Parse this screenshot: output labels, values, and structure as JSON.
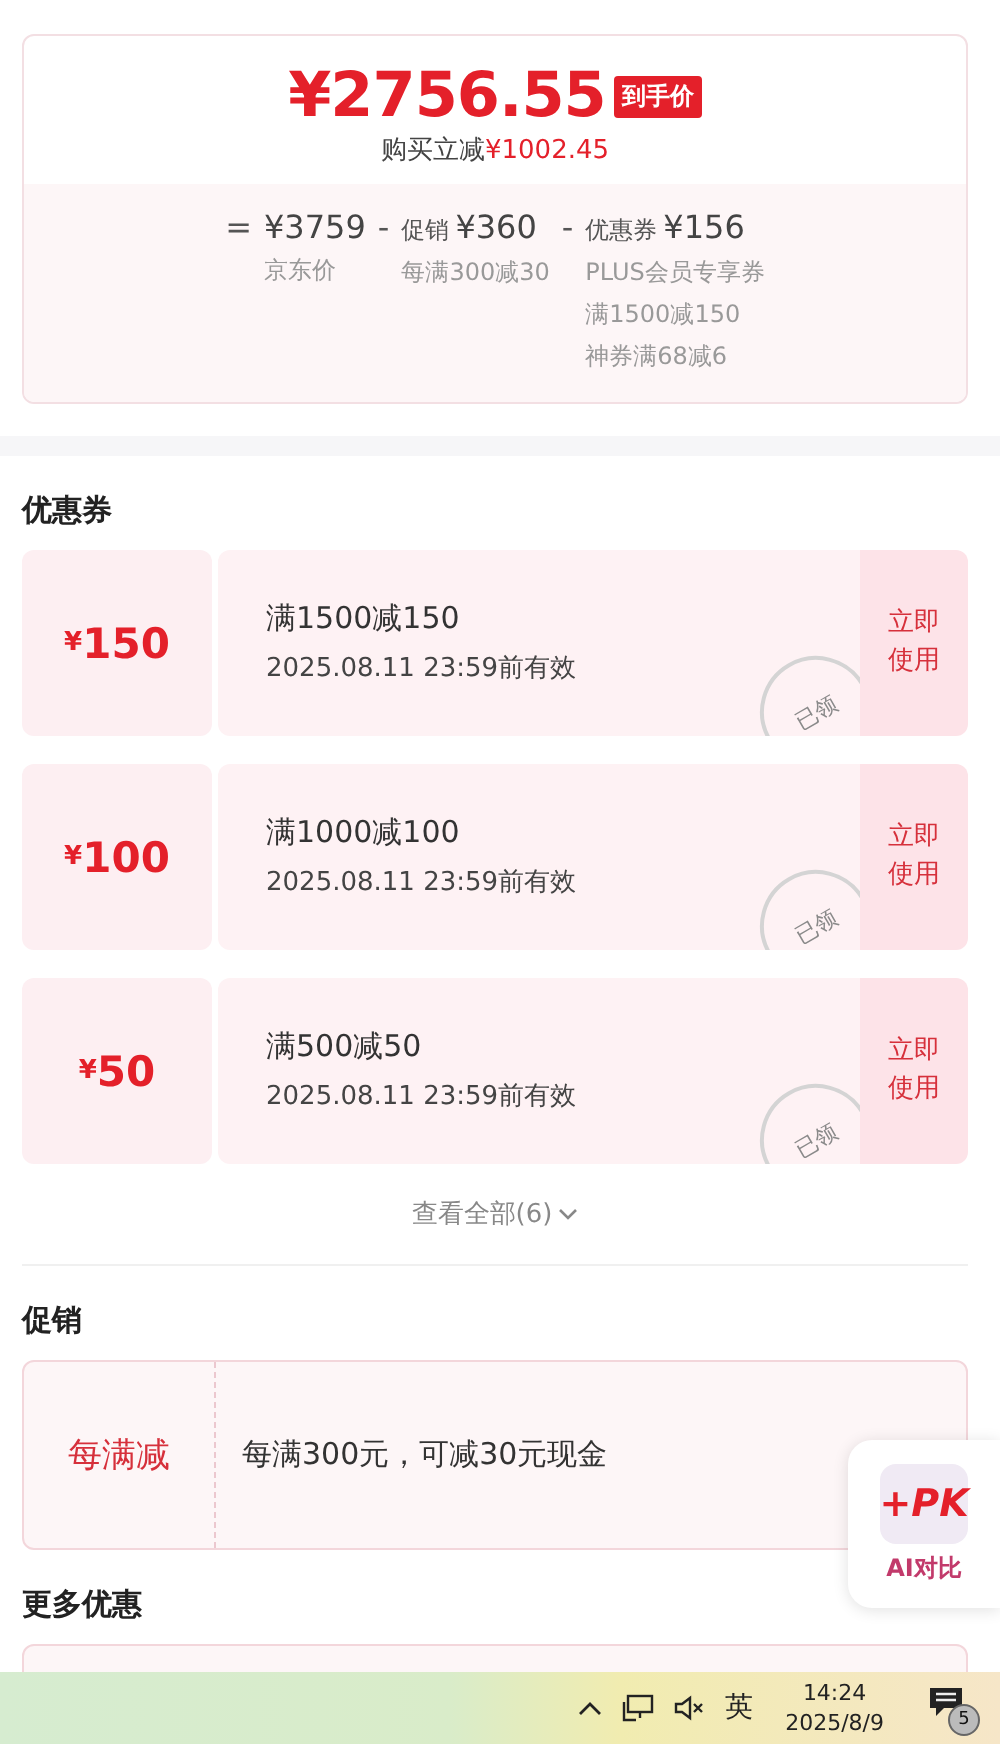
{
  "price_card": {
    "price": "¥2756.55",
    "price_badge": "到手价",
    "saving_label": "购买立减",
    "saving_amount": "¥1002.45",
    "breakdown": [
      {
        "operator": "=",
        "amount": "¥3759",
        "notes": [
          "京东价"
        ]
      },
      {
        "operator": "-",
        "label": "促销",
        "amount": "¥360",
        "notes": [
          "每满300减30"
        ]
      },
      {
        "operator": "-",
        "label": "优惠券",
        "amount": "¥156",
        "notes": [
          "PLUS会员专享券",
          "满1500减150",
          "神券满68减6"
        ]
      }
    ]
  },
  "coupons_section": {
    "title": "优惠券",
    "coupons": [
      {
        "amount": "150",
        "currency": "¥",
        "condition": "满1500减150",
        "validity": "2025.08.11 23:59前有效",
        "action": "立即使用",
        "claimed": true,
        "stamp": "已领"
      },
      {
        "amount": "100",
        "currency": "¥",
        "condition": "满1000减100",
        "validity": "2025.08.11 23:59前有效",
        "action": "立即使用",
        "claimed": true,
        "stamp": "已领"
      },
      {
        "amount": "50",
        "currency": "¥",
        "condition": "满500减50",
        "validity": "2025.08.11 23:59前有效",
        "action": "立即使用",
        "claimed": true,
        "stamp": "已领"
      }
    ],
    "view_all": "查看全部(6)"
  },
  "promotion_section": {
    "title": "促销",
    "promotions": [
      {
        "type": "每满减",
        "description": "每满300元，可减30元现金"
      }
    ]
  },
  "more_section": {
    "title": "更多优惠"
  },
  "ai_compare": {
    "icon_text": "+PK",
    "label": "AI对比"
  },
  "taskbar": {
    "input_method": "英",
    "time": "14:24",
    "date": "2025/8/9",
    "notification_count": "5"
  }
}
